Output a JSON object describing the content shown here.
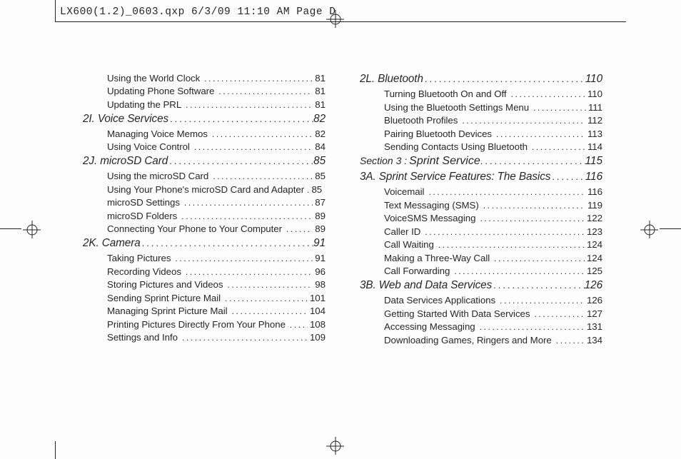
{
  "header": "LX600(1.2)_0603.qxp  6/3/09  11:10 AM  Page D",
  "dotsH": "................................................",
  "dotsI": "........................................................",
  "left": {
    "looseItems": [
      {
        "label": "Using the World Clock",
        "page": "81"
      },
      {
        "label": "Updating Phone Software",
        "page": "81"
      },
      {
        "label": "Updating the PRL",
        "page": "81"
      }
    ],
    "headings": [
      {
        "label": "2I. Voice Services",
        "page": "82",
        "items": [
          {
            "label": "Managing Voice Memos",
            "page": "82"
          },
          {
            "label": "Using Voice Control",
            "page": "84"
          }
        ]
      },
      {
        "label": "2J. microSD Card",
        "page": "85",
        "items": [
          {
            "label": "Using the microSD Card",
            "page": "85"
          },
          {
            "label": "Using Your Phone's microSD Card and Adapter",
            "page": "85",
            "tightDots": true
          },
          {
            "label": "microSD Settings",
            "page": "87"
          },
          {
            "label": "microSD Folders",
            "page": "89"
          },
          {
            "label": "Connecting Your Phone to Your Computer",
            "page": "89"
          }
        ]
      },
      {
        "label": "2K. Camera",
        "page": "91",
        "items": [
          {
            "label": "Taking Pictures",
            "page": "91"
          },
          {
            "label": "Recording Videos",
            "page": "96"
          },
          {
            "label": "Storing Pictures and Videos",
            "page": "98"
          },
          {
            "label": "Sending Sprint Picture Mail",
            "page": "101"
          },
          {
            "label": "Managing Sprint Picture Mail",
            "page": "104"
          },
          {
            "label": "Printing Pictures Directly From Your Phone",
            "page": "108"
          },
          {
            "label": "Settings and Info",
            "page": "109"
          }
        ]
      }
    ]
  },
  "right": {
    "headings1": [
      {
        "label": "2L. Bluetooth",
        "page": "110",
        "items": [
          {
            "label": "Turning Bluetooth On and Off",
            "page": "110"
          },
          {
            "label": "Using the Bluetooth Settings Menu",
            "page": "111"
          },
          {
            "label": "Bluetooth Profiles",
            "page": "112"
          },
          {
            "label": "Pairing Bluetooth Devices",
            "page": "113"
          },
          {
            "label": "Sending Contacts Using Bluetooth",
            "page": "114"
          }
        ]
      }
    ],
    "section": {
      "prefix": "Section 3 :",
      "label": "Sprint Service",
      "page": "115"
    },
    "headings2": [
      {
        "label": "3A. Sprint Service Features: The Basics",
        "page": "116",
        "items": [
          {
            "label": "Voicemail",
            "page": "116"
          },
          {
            "label": "Text Messaging (SMS)",
            "page": "119"
          },
          {
            "label": "VoiceSMS Messaging",
            "page": "122"
          },
          {
            "label": "Caller ID",
            "page": "123"
          },
          {
            "label": "Call Waiting",
            "page": "124"
          },
          {
            "label": "Making a Three-Way Call",
            "page": "124"
          },
          {
            "label": "Call Forwarding",
            "page": "125"
          }
        ]
      },
      {
        "label": "3B. Web and Data Services",
        "page": "126",
        "items": [
          {
            "label": "Data Services Applications",
            "page": "126"
          },
          {
            "label": "Getting Started With Data Services",
            "page": "127"
          },
          {
            "label": "Accessing Messaging",
            "page": "131"
          },
          {
            "label": "Downloading Games, Ringers and More",
            "page": "134"
          }
        ]
      }
    ]
  }
}
